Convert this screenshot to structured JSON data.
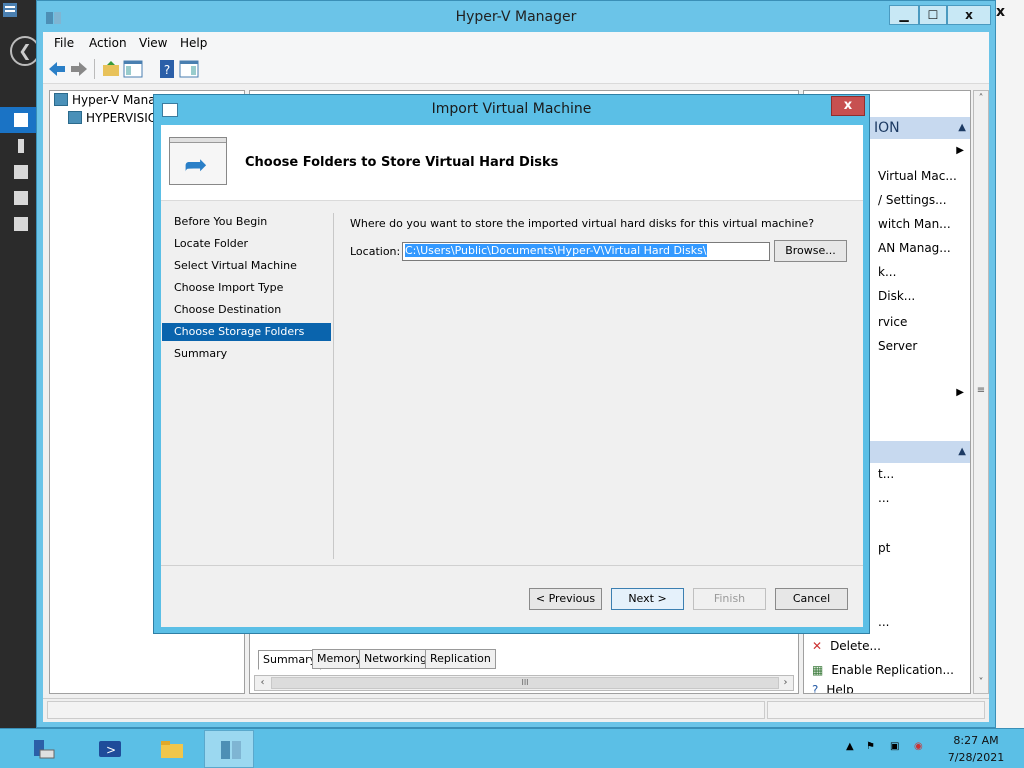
{
  "window": {
    "title": "Hyper-V Manager",
    "minimize": "▁",
    "maximize": "☐",
    "close": "x"
  },
  "menu": [
    "File",
    "Action",
    "View",
    "Help"
  ],
  "tree": {
    "root": "Hyper-V Manager",
    "server": "HYPERVISION"
  },
  "center": {
    "tabs": [
      "Summary",
      "Memory",
      "Networking",
      "Replication"
    ],
    "scroll_thumb": "III"
  },
  "actions": {
    "header1": "ION",
    "items": [
      "Virtual Mac...",
      "/ Settings...",
      "witch Man...",
      "AN Manag...",
      "k...",
      "Disk...",
      "rvice",
      "Server"
    ],
    "items2": [
      "t...",
      "...",
      "pt",
      "..."
    ],
    "bottom_items": [
      "Delete...",
      "Enable Replication...",
      "Help"
    ]
  },
  "dialog": {
    "title": "Import Virtual Machine",
    "close": "x",
    "heading": "Choose Folders to Store Virtual Hard Disks",
    "steps": [
      "Before You Begin",
      "Locate Folder",
      "Select Virtual Machine",
      "Choose Import Type",
      "Choose Destination",
      "Choose Storage Folders",
      "Summary"
    ],
    "active_step": "Choose Storage Folders",
    "question": "Where do you want to store the imported virtual hard disks for this virtual machine?",
    "location_label": "Location:",
    "location_value": "C:\\Users\\Public\\Documents\\Hyper-V\\Virtual Hard Disks\\",
    "browse": "Browse...",
    "buttons": {
      "previous": "< Previous",
      "next": "Next >",
      "finish": "Finish",
      "cancel": "Cancel"
    }
  },
  "taskbar": {
    "time": "8:27 AM",
    "date": "7/28/2021"
  },
  "colors": {
    "accent": "#5bbfe6",
    "selection": "#0a64ad"
  }
}
